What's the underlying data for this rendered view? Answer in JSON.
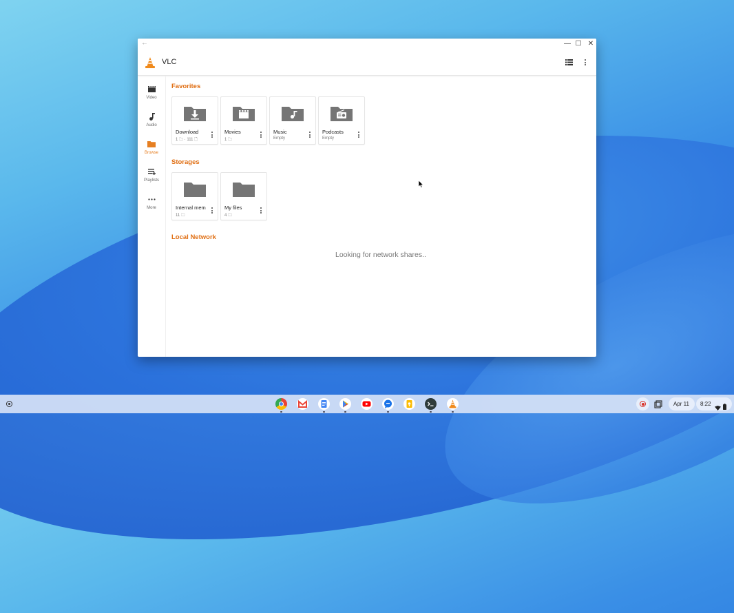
{
  "window": {
    "title": "VLC",
    "back_glyph": "←",
    "minimize_glyph": "—",
    "maximize_glyph": "☐",
    "close_glyph": "✕"
  },
  "rail": {
    "items": [
      {
        "label": "Video",
        "icon": "clapperboard-icon",
        "active": false
      },
      {
        "label": "Audio",
        "icon": "music-note-icon",
        "active": false
      },
      {
        "label": "Browse",
        "icon": "folder-icon",
        "active": true
      },
      {
        "label": "Playlists",
        "icon": "playlist-icon",
        "active": false
      },
      {
        "label": "More",
        "icon": "more-horizontal-icon",
        "active": false
      }
    ]
  },
  "sections": {
    "favorites": "Favorites",
    "storages": "Storages",
    "local_network": "Local Network"
  },
  "favorites": [
    {
      "name": "Download",
      "sub": "1 🗀 · 111 🗋",
      "icon": "download-folder-icon"
    },
    {
      "name": "Movies",
      "sub": "1 🗀",
      "icon": "movies-folder-icon"
    },
    {
      "name": "Music",
      "sub": "Empty",
      "icon": "music-folder-icon"
    },
    {
      "name": "Podcasts",
      "sub": "Empty",
      "icon": "podcast-folder-icon"
    }
  ],
  "storages": [
    {
      "name": "Internal mem",
      "sub": "11 🗀",
      "icon": "folder-icon"
    },
    {
      "name": "My files",
      "sub": "4 🗀",
      "icon": "folder-icon"
    }
  ],
  "network_status": "Looking for network shares..",
  "shelf": {
    "apps": [
      "chrome-icon",
      "gmail-icon",
      "docs-icon",
      "play-store-icon",
      "youtube-icon",
      "messages-icon",
      "keep-icon",
      "terminal-icon",
      "vlc-icon"
    ],
    "date": "Apr 11",
    "time": "8:22"
  },
  "colors": {
    "accent": "#e06f14",
    "folder_grey": "#757575"
  }
}
